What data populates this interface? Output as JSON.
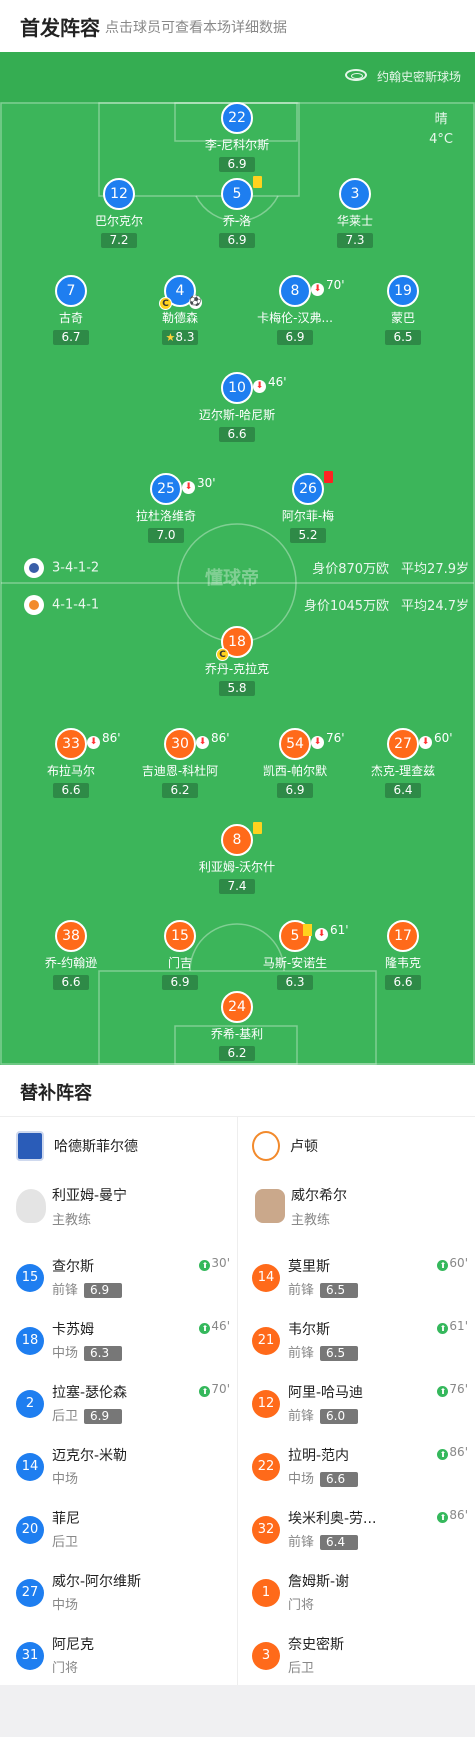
{
  "header": {
    "title": "首发阵容",
    "subtitle": "点击球员可查看本场详细数据"
  },
  "venue": {
    "name": "约翰史密斯球场",
    "weather": "晴",
    "temp": "4°C"
  },
  "watermark": "懂球帝",
  "colors": {
    "pitch": "#3cb55a",
    "home": "#1e7ef0",
    "away": "#ff6a1a"
  },
  "home": {
    "formation": "3-4-1-2",
    "value": "身价870万欧",
    "age": "平均27.9岁",
    "players": [
      {
        "num": "22",
        "name": "李-尼科尔斯",
        "rating": "6.9"
      },
      {
        "num": "12",
        "name": "巴尔克尔",
        "rating": "7.2"
      },
      {
        "num": "5",
        "name": "乔-洛",
        "rating": "6.9"
      },
      {
        "num": "3",
        "name": "华莱士",
        "rating": "7.3"
      },
      {
        "num": "7",
        "name": "古奇",
        "rating": "6.7"
      },
      {
        "num": "4",
        "name": "勒德森",
        "rating": "8.3"
      },
      {
        "num": "8",
        "name": "卡梅伦-汉弗...",
        "rating": "6.9",
        "sub": "70'"
      },
      {
        "num": "19",
        "name": "蒙巴",
        "rating": "6.5"
      },
      {
        "num": "10",
        "name": "迈尔斯-哈尼斯",
        "rating": "6.6",
        "sub": "46'"
      },
      {
        "num": "25",
        "name": "拉杜洛维奇",
        "rating": "7.0",
        "sub": "30'"
      },
      {
        "num": "26",
        "name": "阿尔菲-梅",
        "rating": "5.2"
      }
    ]
  },
  "away": {
    "formation": "4-1-4-1",
    "value": "身价1045万欧",
    "age": "平均24.7岁",
    "players": [
      {
        "num": "18",
        "name": "乔丹-克拉克",
        "rating": "5.8"
      },
      {
        "num": "33",
        "name": "布拉马尔",
        "rating": "6.6",
        "sub": "86'"
      },
      {
        "num": "30",
        "name": "吉迪恩-科杜阿",
        "rating": "6.2",
        "sub": "86'"
      },
      {
        "num": "54",
        "name": "凯西-帕尔默",
        "rating": "6.9",
        "sub": "76'"
      },
      {
        "num": "27",
        "name": "杰克-理查兹",
        "rating": "6.4",
        "sub": "60'"
      },
      {
        "num": "8",
        "name": "利亚姆-沃尔什",
        "rating": "7.4"
      },
      {
        "num": "38",
        "name": "乔-约翰逊",
        "rating": "6.6"
      },
      {
        "num": "15",
        "name": "门吉",
        "rating": "6.9"
      },
      {
        "num": "5",
        "name": "马斯-安诺生",
        "rating": "6.3",
        "sub": "61'"
      },
      {
        "num": "17",
        "name": "隆韦克",
        "rating": "6.6"
      },
      {
        "num": "24",
        "name": "乔希-基利",
        "rating": "6.2"
      }
    ]
  },
  "subs": {
    "title": "替补阵容",
    "home": {
      "team": "哈德斯菲尔德",
      "coach": "利亚姆-曼宁",
      "coach_role": "主教练",
      "items": [
        {
          "num": "15",
          "name": "查尔斯",
          "pos": "前锋",
          "rating": "6.9",
          "time": "30'"
        },
        {
          "num": "18",
          "name": "卡苏姆",
          "pos": "中场",
          "rating": "6.3",
          "time": "46'"
        },
        {
          "num": "2",
          "name": "拉塞-瑟伦森",
          "pos": "后卫",
          "rating": "6.9",
          "time": "70'"
        },
        {
          "num": "14",
          "name": "迈克尔-米勒",
          "pos": "中场"
        },
        {
          "num": "20",
          "name": "菲尼",
          "pos": "后卫"
        },
        {
          "num": "27",
          "name": "威尔-阿尔维斯",
          "pos": "中场"
        },
        {
          "num": "31",
          "name": "阿尼克",
          "pos": "门将"
        }
      ]
    },
    "away": {
      "team": "卢顿",
      "coach": "威尔希尔",
      "coach_role": "主教练",
      "items": [
        {
          "num": "14",
          "name": "莫里斯",
          "pos": "前锋",
          "rating": "6.5",
          "time": "60'"
        },
        {
          "num": "21",
          "name": "韦尔斯",
          "pos": "前锋",
          "rating": "6.5",
          "time": "61'"
        },
        {
          "num": "12",
          "name": "阿里-哈马迪",
          "pos": "前锋",
          "rating": "6.0",
          "time": "76'"
        },
        {
          "num": "22",
          "name": "拉明-范内",
          "pos": "中场",
          "rating": "6.6",
          "time": "86'"
        },
        {
          "num": "32",
          "name": "埃米利奥-劳...",
          "pos": "前锋",
          "rating": "6.4",
          "time": "86'"
        },
        {
          "num": "1",
          "name": "詹姆斯-谢",
          "pos": "门将"
        },
        {
          "num": "3",
          "name": "奈史密斯",
          "pos": "后卫"
        }
      ]
    }
  }
}
